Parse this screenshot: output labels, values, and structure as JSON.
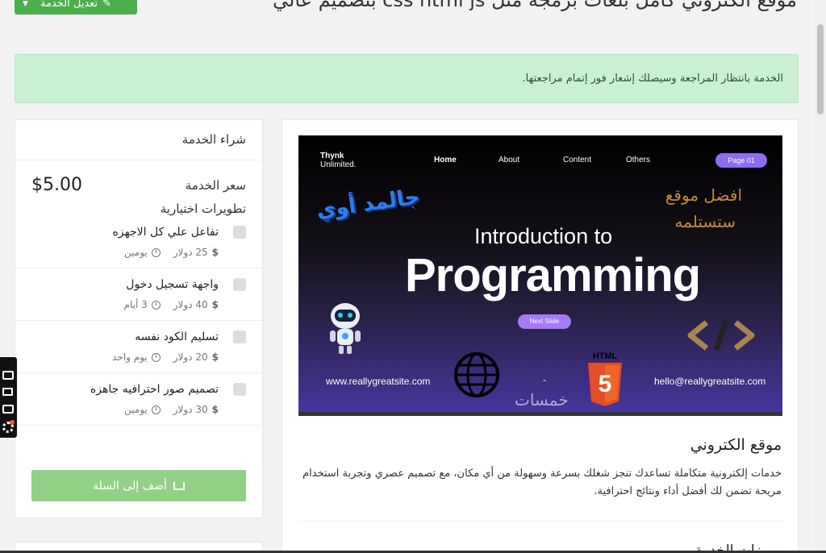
{
  "header": {
    "title": "موقع الكتروني كامل بلغات برمجة مثل css html js بتصميم عالي",
    "edit_button": "تعديل الخدمة"
  },
  "alert": {
    "text": "الخدمة بانتظار المراجعة وسيصلك إشعار فور إتمام مراجعتها."
  },
  "buy": {
    "title": "شراء الخدمة",
    "price_label": "سعر الخدمة",
    "price": "$5.00",
    "addons_title": "تطويرات اختيارية",
    "addons": [
      {
        "name": "تفاعل علي كل الاجهزه",
        "price": "25 دولار",
        "duration": "يومين"
      },
      {
        "name": "واجهة تسجيل دخول",
        "price": "40 دولار",
        "duration": "3 أيام"
      },
      {
        "name": "تسليم الكود نفسه",
        "price": "20 دولار",
        "duration": "يوم واحد"
      },
      {
        "name": "تصميم صور احترافيه جاهزه",
        "price": "30 دولار",
        "duration": "يومين"
      }
    ],
    "add_to_cart": "أضف إلى السلة"
  },
  "hero": {
    "brand_line1": "Thynk",
    "brand_line2": "Unlimited.",
    "nav": [
      "Home",
      "About",
      "Content",
      "Others"
    ],
    "page_badge": "Page 01",
    "arabic_line1": "افضل موقع",
    "arabic_line2": "ستستلمه",
    "logo_text": "جالمد أوي",
    "intro": "Introduction to",
    "headline": "Programming",
    "next_badge": "Next Slide",
    "site": "www.reallygreatsite.com",
    "dash": "-",
    "email": "hello@reallygreatsite.com",
    "watermark": "خمسات",
    "html5_label": "HTML"
  },
  "service": {
    "title": "موقع الكتروني",
    "description": "خدمات إلكترونية متكاملة تساعدك تنجز شغلك بسرعة وسهولة من أي مكان، مع تصميم عصري وتجربة استخدام مريحة تضمن لك أفضل أداء ونتائج احترافية.",
    "features_title": "مميزات الخدمة"
  },
  "colors": {
    "primary_green": "#4cae4c",
    "alert_bg": "#c9f0d3",
    "cart_button": "#92d185",
    "hero_accent": "#8d6cf2"
  }
}
